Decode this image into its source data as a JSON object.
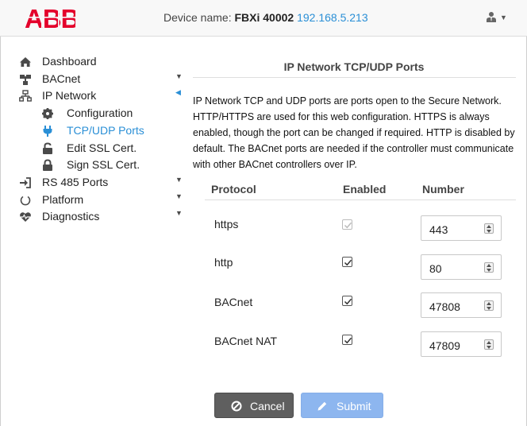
{
  "header": {
    "logo_text": "ABB",
    "device_label": "Device name:",
    "device_id": "FBXi 40002",
    "device_ip": "192.168.5.213",
    "user_icon": "user-tie-icon",
    "brand_color": "#e4002b"
  },
  "sidebar": {
    "items": [
      {
        "label": "Dashboard",
        "icon": "home-icon"
      },
      {
        "label": "BACnet",
        "icon": "network-icon"
      },
      {
        "label": "IP Network",
        "icon": "sitemap-icon"
      },
      {
        "label": "Configuration",
        "icon": "cog-icon"
      },
      {
        "label": "TCP/UDP Ports",
        "icon": "plug-icon",
        "active": true
      },
      {
        "label": "Edit SSL Cert.",
        "icon": "unlock-icon"
      },
      {
        "label": "Sign SSL Cert.",
        "icon": "lock-icon"
      },
      {
        "label": "RS 485 Ports",
        "icon": "sign-in-icon"
      },
      {
        "label": "Platform",
        "icon": "power-icon"
      },
      {
        "label": "Diagnostics",
        "icon": "heartbeat-icon"
      }
    ],
    "active_color": "#2a8fd6"
  },
  "main": {
    "title": "IP Network TCP/UDP Ports",
    "description": "IP Network TCP and UDP ports are ports open to the Secure Network. HTTP/HTTPS are used for this web configuration. HTTPS is always enabled, though the port can be changed if required. HTTP is disabled by default. The BACnet ports are needed if the controller must communicate with other BACnet controllers over IP.",
    "columns": {
      "protocol": "Protocol",
      "enabled": "Enabled",
      "number": "Number"
    },
    "rows": [
      {
        "protocol": "https",
        "enabled": true,
        "disabled": true,
        "number": "443"
      },
      {
        "protocol": "http",
        "enabled": true,
        "disabled": false,
        "number": "80"
      },
      {
        "protocol": "BACnet",
        "enabled": true,
        "disabled": false,
        "number": "47808"
      },
      {
        "protocol": "BACnet NAT",
        "enabled": true,
        "disabled": false,
        "number": "47809"
      }
    ],
    "cancel_label": "Cancel",
    "submit_label": "Submit",
    "cancel_icon": "ban-icon",
    "submit_icon": "pencil-icon"
  }
}
